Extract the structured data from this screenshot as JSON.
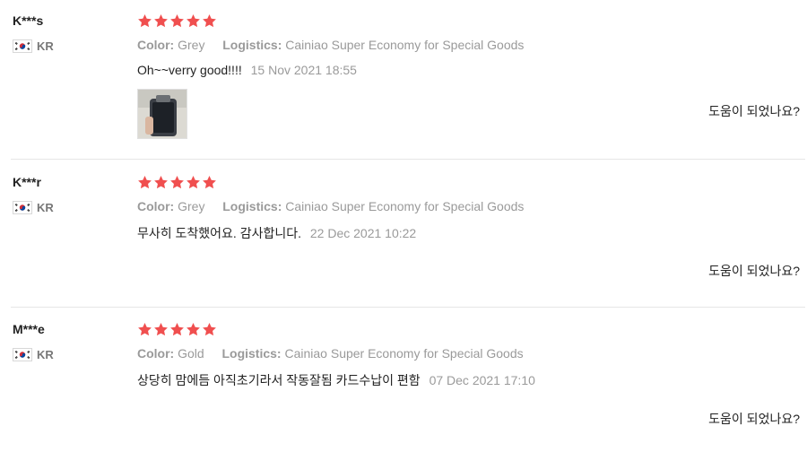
{
  "reviews": [
    {
      "user": "K***s",
      "country": "KR",
      "rating": 5,
      "color_label": "Color:",
      "color_value": "Grey",
      "logistics_label": "Logistics:",
      "logistics_value": "Cainiao Super Economy for Special Goods",
      "text": "Oh~~verry good!!!!",
      "date": "15 Nov 2021 18:55",
      "has_photo": true,
      "helpful_label": "도움이 되었나요?"
    },
    {
      "user": "K***r",
      "country": "KR",
      "rating": 5,
      "color_label": "Color:",
      "color_value": "Grey",
      "logistics_label": "Logistics:",
      "logistics_value": "Cainiao Super Economy for Special Goods",
      "text": "무사히 도착했어요. 감사합니다.",
      "date": "22 Dec 2021 10:22",
      "has_photo": false,
      "helpful_label": "도움이 되었나요?"
    },
    {
      "user": "M***e",
      "country": "KR",
      "rating": 5,
      "color_label": "Color:",
      "color_value": "Gold",
      "logistics_label": "Logistics:",
      "logistics_value": "Cainiao Super Economy for Special Goods",
      "text": "상당히 맘에듬 아직초기라서 작동잘됨 카드수납이 편함",
      "date": "07 Dec 2021 17:10",
      "has_photo": false,
      "helpful_label": "도움이 되었나요?"
    }
  ],
  "colors": {
    "star": "#f04f4f",
    "meta": "#9a9a9a",
    "divider": "#e6e6e6"
  },
  "icons": {
    "star": "star-icon",
    "flag": "korea-flag-icon"
  }
}
